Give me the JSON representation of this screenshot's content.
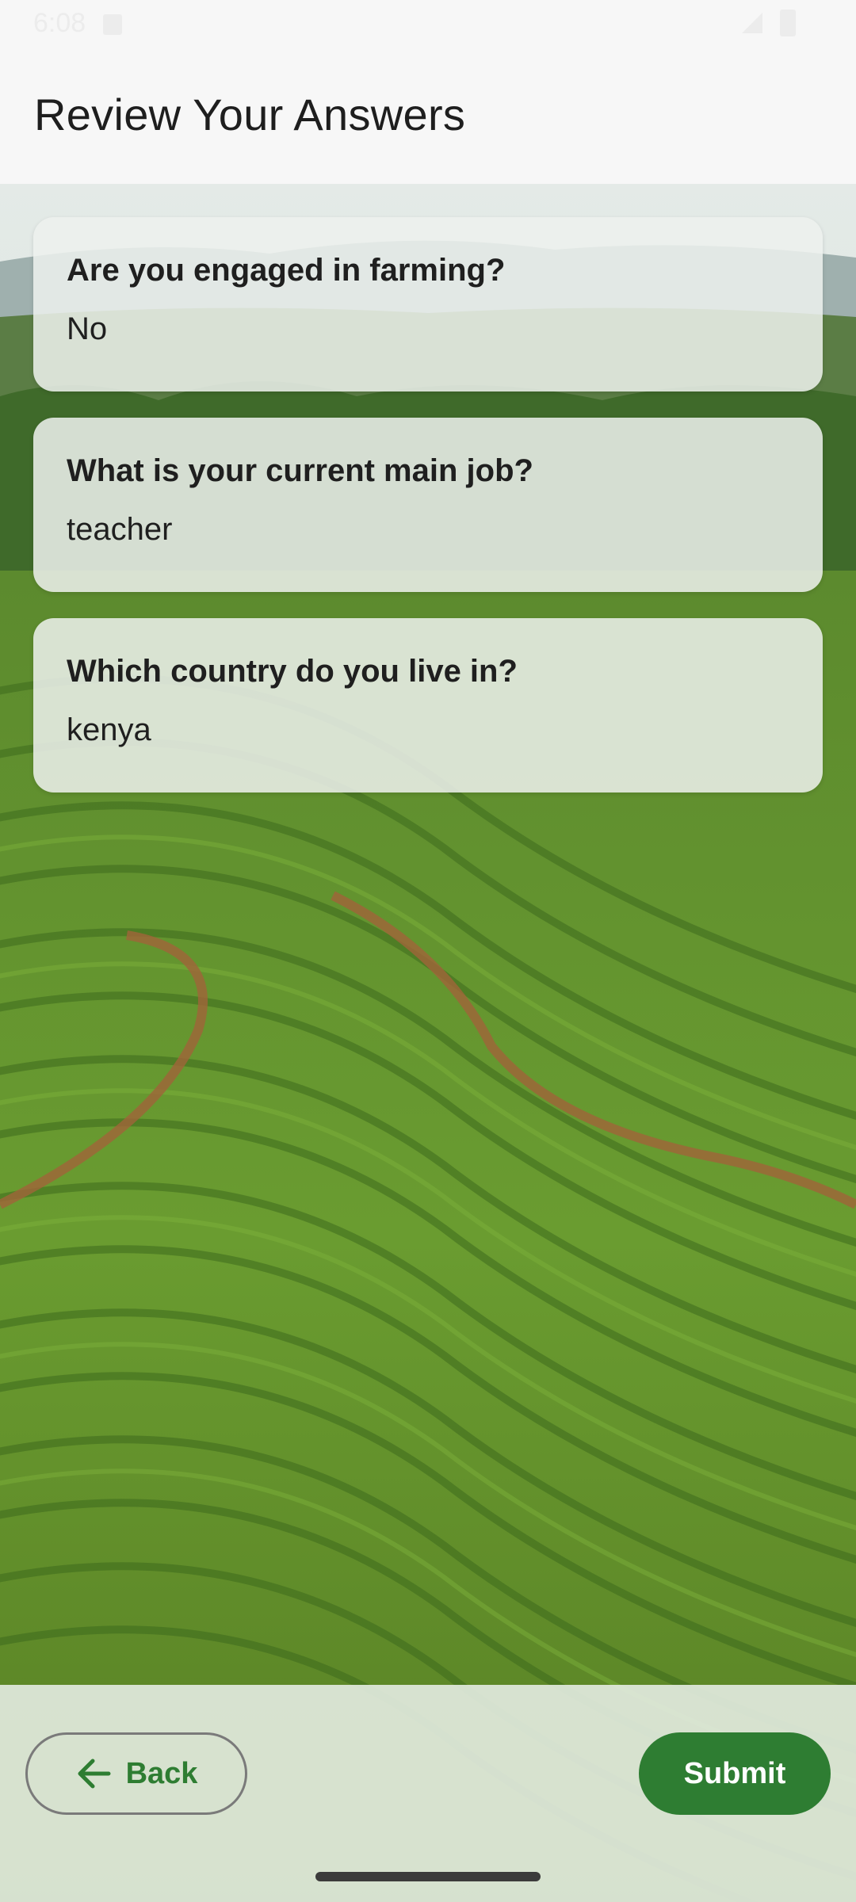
{
  "status_bar": {
    "time": "6:08",
    "notification_icon": "notification-icon",
    "signal_icon": "signal-icon",
    "battery_icon": "battery-icon"
  },
  "header": {
    "title": "Review Your Answers"
  },
  "answers": [
    {
      "question": "Are you engaged in farming?",
      "answer": "No"
    },
    {
      "question": "What is your current main job?",
      "answer": "teacher"
    },
    {
      "question": "Which country do you live in?",
      "answer": "kenya"
    }
  ],
  "footer": {
    "back_label": "Back",
    "back_icon": "arrow-left-icon",
    "submit_label": "Submit"
  },
  "colors": {
    "accent": "#2e7d32",
    "header_bg": "#f7f7f7",
    "card_bg": "#eef1ee",
    "text": "#1f1f1f"
  },
  "background_image": "tea-plantation-landscape"
}
